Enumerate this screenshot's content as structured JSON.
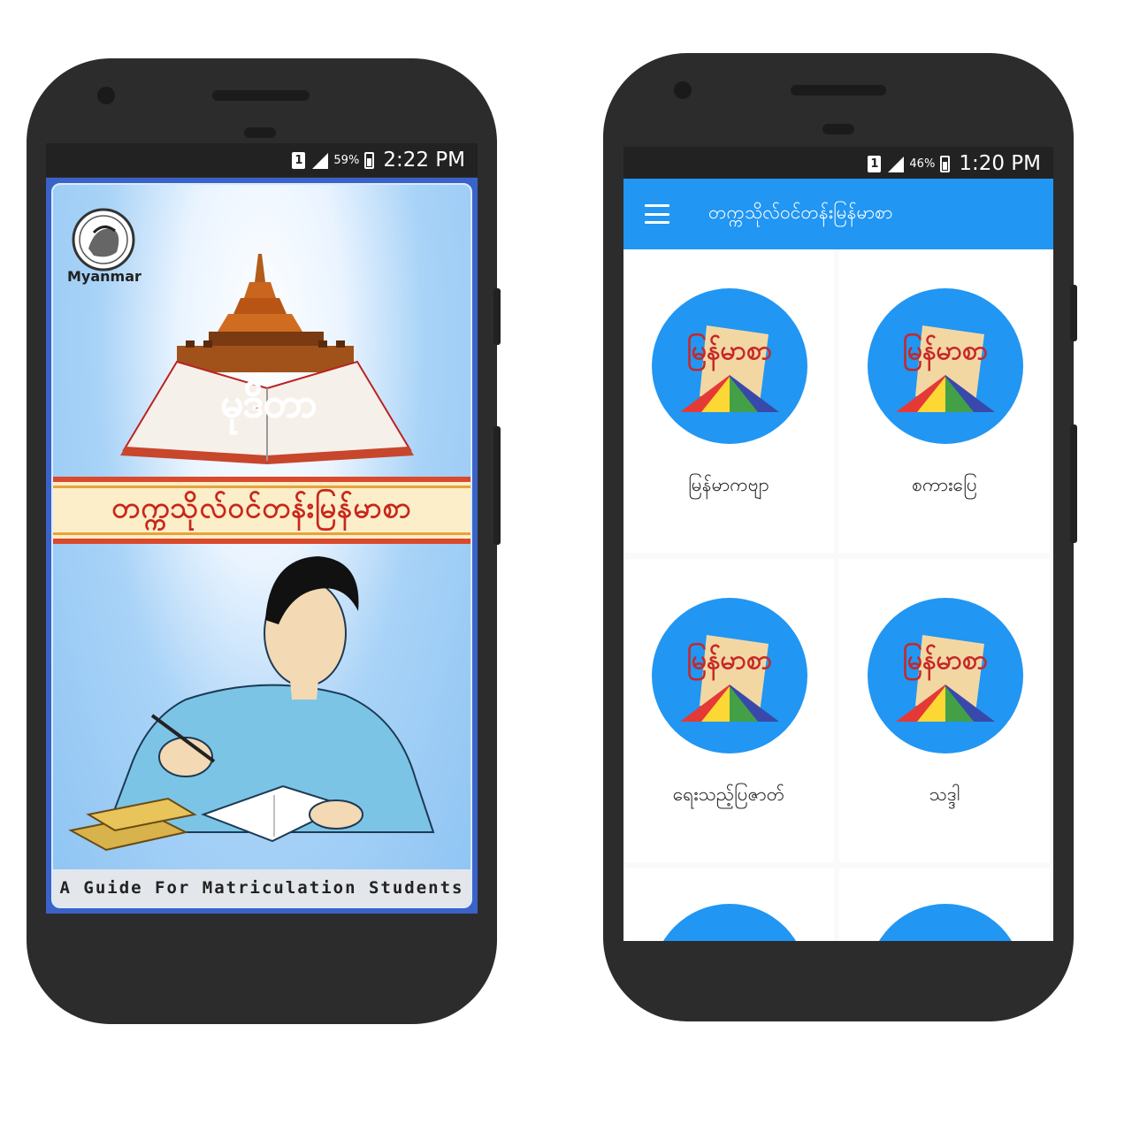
{
  "phone_left": {
    "status_bar": {
      "sim": "1",
      "battery_pct": "59%",
      "time": "2:22 PM"
    },
    "splash": {
      "logo_text": "Myanmar",
      "hero_title": "မုဒိတာ",
      "band_title": "တက္ကသိုလ်ဝင်တန်းမြန်မာစာ",
      "subtitle": "A Guide For Matriculation Students"
    }
  },
  "phone_right": {
    "status_bar": {
      "sim": "1",
      "battery_pct": "46%",
      "time": "1:20 PM"
    },
    "appbar": {
      "title": "တက္ကသိုလ်ဝင်တန်းမြန်မာစာ",
      "menu_icon": "hamburger-menu-icon"
    },
    "grid_items": [
      {
        "label": "မြန်မာကဗျာ"
      },
      {
        "label": "စကားပြေ"
      },
      {
        "label": "ရေးသည့်ပြဇာတ်"
      },
      {
        "label": "သဒ္ဒါ"
      }
    ],
    "tile_icon_text": "မြန်မာစာ",
    "colors": {
      "primary": "#2196f3",
      "title_red": "#c8271c"
    }
  }
}
